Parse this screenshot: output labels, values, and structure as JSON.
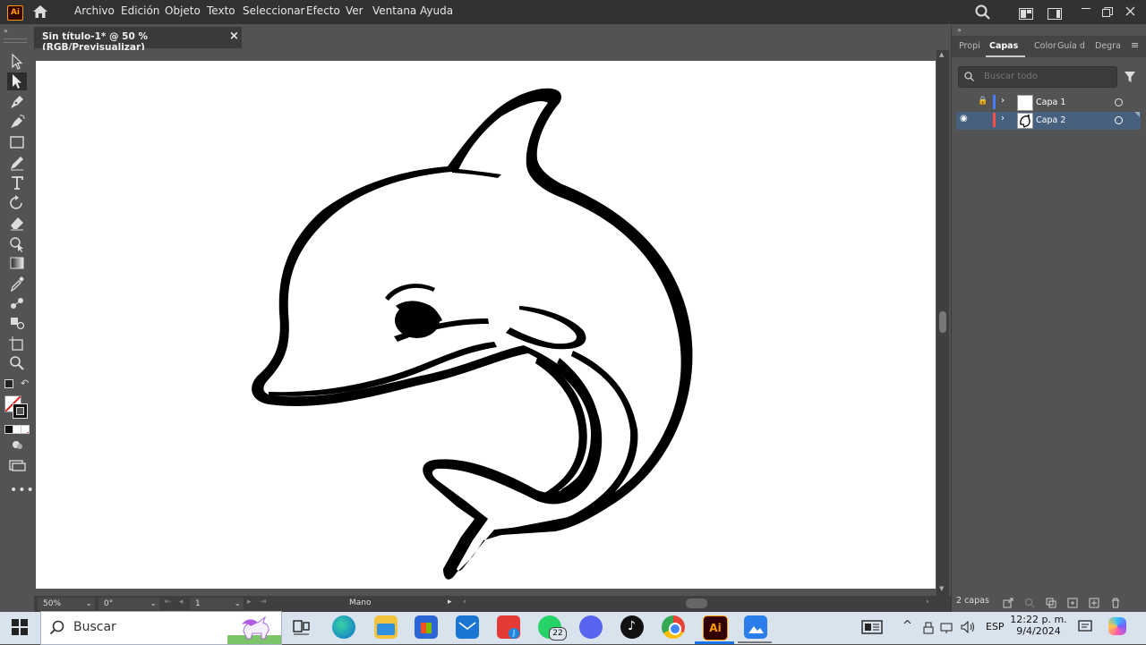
{
  "app": {
    "logo": "Ai"
  },
  "menu": [
    "Archivo",
    "Edición",
    "Objeto",
    "Texto",
    "Seleccionar",
    "Efecto",
    "Ver",
    "Ventana",
    "Ayuda"
  ],
  "document_tab": {
    "title": "Sin título-1* @ 50 % (RGB/Previsualizar)",
    "close": "×"
  },
  "panel": {
    "tabs": [
      "Propi",
      "Capas",
      "Color",
      "Guía d",
      "Degra"
    ],
    "active_tab": "Capas",
    "search_placeholder": "Buscar todo",
    "layers": [
      {
        "name": "Capa 1",
        "color": "#4a7cff",
        "locked": true,
        "visible": false
      },
      {
        "name": "Capa 2",
        "color": "#ff4d4d",
        "locked": false,
        "visible": true
      }
    ],
    "layer_count": "2 capas"
  },
  "status": {
    "zoom": "50%",
    "angle": "0°",
    "artboard": "1",
    "tool": "Mano"
  },
  "taskbar": {
    "search_label": "Buscar",
    "whatsapp_badge": "22",
    "language": "ESP",
    "time": "12:22 p. m.",
    "date": "9/4/2024",
    "adobe_label": "Ai"
  },
  "colors": {
    "accent_ai": "#ff9a00",
    "selected_layer": "#46607e"
  }
}
